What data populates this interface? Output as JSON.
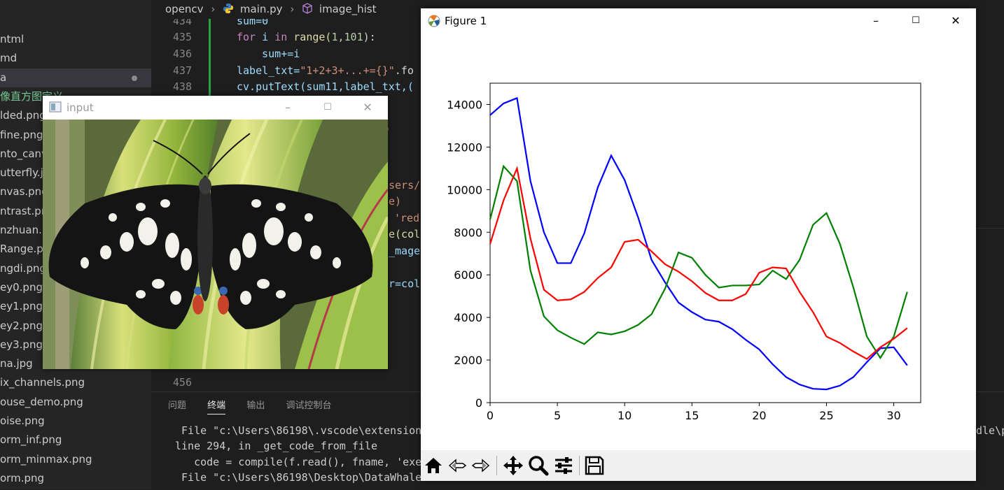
{
  "vscode": {
    "breadcrumb": {
      "folder": "opencv",
      "file": "main.py",
      "symbol": "image_hist"
    },
    "sidebar_files": [
      {
        "label": "ntml",
        "active": false,
        "chinese": false
      },
      {
        "label": "md",
        "active": false,
        "chinese": false
      },
      {
        "label": "a",
        "active": true,
        "chinese": false
      },
      {
        "label": "像直方图定义",
        "active": false,
        "chinese": true
      },
      {
        "label": "lded.png",
        "active": false,
        "chinese": false
      },
      {
        "label": "fine.png",
        "active": false,
        "chinese": false
      },
      {
        "label": "nto_canva",
        "active": false,
        "chinese": false
      },
      {
        "label": "utterfly.jp",
        "active": false,
        "chinese": false
      },
      {
        "label": "nvas.png",
        "active": false,
        "chinese": false
      },
      {
        "label": "ntrast.pn",
        "active": false,
        "chinese": false
      },
      {
        "label": "nzhuan.p",
        "active": false,
        "chinese": false
      },
      {
        "label": "Range.pn",
        "active": false,
        "chinese": false
      },
      {
        "label": "ngdi.png",
        "active": false,
        "chinese": false
      },
      {
        "label": "ey0.png",
        "active": false,
        "chinese": false
      },
      {
        "label": "ey1.png",
        "active": false,
        "chinese": false
      },
      {
        "label": "ey2.png",
        "active": false,
        "chinese": false
      },
      {
        "label": "ey3.png",
        "active": false,
        "chinese": false
      },
      {
        "label": "na.jpg",
        "active": false,
        "chinese": false
      },
      {
        "label": "ix_channels.png",
        "active": false,
        "chinese": false
      },
      {
        "label": "ouse_demo.png",
        "active": false,
        "chinese": false
      },
      {
        "label": "oise.png",
        "active": false,
        "chinese": false
      },
      {
        "label": "orm_inf.png",
        "active": false,
        "chinese": false
      },
      {
        "label": "orm_minmax.png",
        "active": false,
        "chinese": false
      },
      {
        "label": "orm.png",
        "active": false,
        "chinese": false
      }
    ],
    "line_numbers": [
      "434",
      "435",
      "436",
      "437",
      "438"
    ],
    "last_line_number": "456",
    "code": {
      "l434": "sum=0",
      "l435_kw": "for",
      "l435_rest1": " i ",
      "l435_in": "in",
      "l435_range": " range(",
      "l435_args": "1,101",
      "l435_close": "):",
      "l436": "    sum+=i",
      "l437_var": "label_txt=",
      "l437_str": "\"1+2+3+...+={}\"",
      "l437_rest": ".fo",
      "l438": "cv.putText(sum11,label_txt,(",
      "frag1": ")",
      "frag2": "\"\"\"",
      "frag3": "sers/",
      "frag4": "e)",
      "frag5": "'red'",
      "frag6": "e(col",
      "frag7": "_mage]",
      "frag8": "r=col"
    },
    "right_fragment": "dle\\p",
    "terminal": {
      "tabs": [
        "问题",
        "终端",
        "输出",
        "调试控制台"
      ],
      "active_tab": "终端",
      "lines": [
        " File \"c:\\Users\\86198\\.vscode\\extension",
        "line 294, in _get_code_from_file",
        "   code = compile(f.read(), fname, 'exe",
        " File \"c:\\Users\\86198\\Desktop\\DataWhale"
      ]
    }
  },
  "input_window": {
    "title": "input"
  },
  "figure_window": {
    "title": "Figure 1",
    "toolbar": [
      "home-icon",
      "back-icon",
      "forward-icon",
      "pan-icon",
      "zoom-icon",
      "configure-icon",
      "save-icon"
    ]
  },
  "chart_data": {
    "type": "line",
    "title": "",
    "xlabel": "",
    "ylabel": "",
    "xlim": [
      0,
      32
    ],
    "ylim": [
      0,
      15000
    ],
    "xticks": [
      0,
      5,
      10,
      15,
      20,
      25,
      30
    ],
    "yticks": [
      0,
      2000,
      4000,
      6000,
      8000,
      10000,
      12000,
      14000
    ],
    "grid": false,
    "x": [
      0,
      1,
      2,
      3,
      4,
      5,
      6,
      7,
      8,
      9,
      10,
      11,
      12,
      13,
      14,
      15,
      16,
      17,
      18,
      19,
      20,
      21,
      22,
      23,
      24,
      25,
      26,
      27,
      28,
      29,
      30,
      31
    ],
    "series": [
      {
        "color": "#0000ff",
        "values": [
          13500,
          14050,
          14300,
          10400,
          8000,
          6550,
          6550,
          7950,
          10100,
          11600,
          10450,
          8700,
          6700,
          5650,
          4700,
          4250,
          3900,
          3800,
          3450,
          2950,
          2500,
          1800,
          1200,
          850,
          650,
          620,
          800,
          1200,
          1900,
          2550,
          2600,
          1750
        ]
      },
      {
        "color": "#008000",
        "values": [
          8600,
          11100,
          10400,
          6200,
          4050,
          3400,
          3050,
          2750,
          3300,
          3200,
          3350,
          3650,
          4150,
          5350,
          7050,
          6800,
          6000,
          5400,
          5500,
          5500,
          5550,
          6200,
          5800,
          6700,
          8350,
          8900,
          7450,
          5400,
          3100,
          2100,
          3100,
          5200
        ]
      },
      {
        "color": "#ff0000",
        "values": [
          7450,
          9500,
          11000,
          7700,
          5300,
          4800,
          4850,
          5200,
          5850,
          6350,
          7550,
          7650,
          7100,
          6500,
          6150,
          5700,
          5150,
          4800,
          4800,
          5100,
          6100,
          6350,
          6300,
          5200,
          4250,
          3100,
          2800,
          2400,
          2050,
          2600,
          3000,
          3500
        ]
      }
    ]
  }
}
